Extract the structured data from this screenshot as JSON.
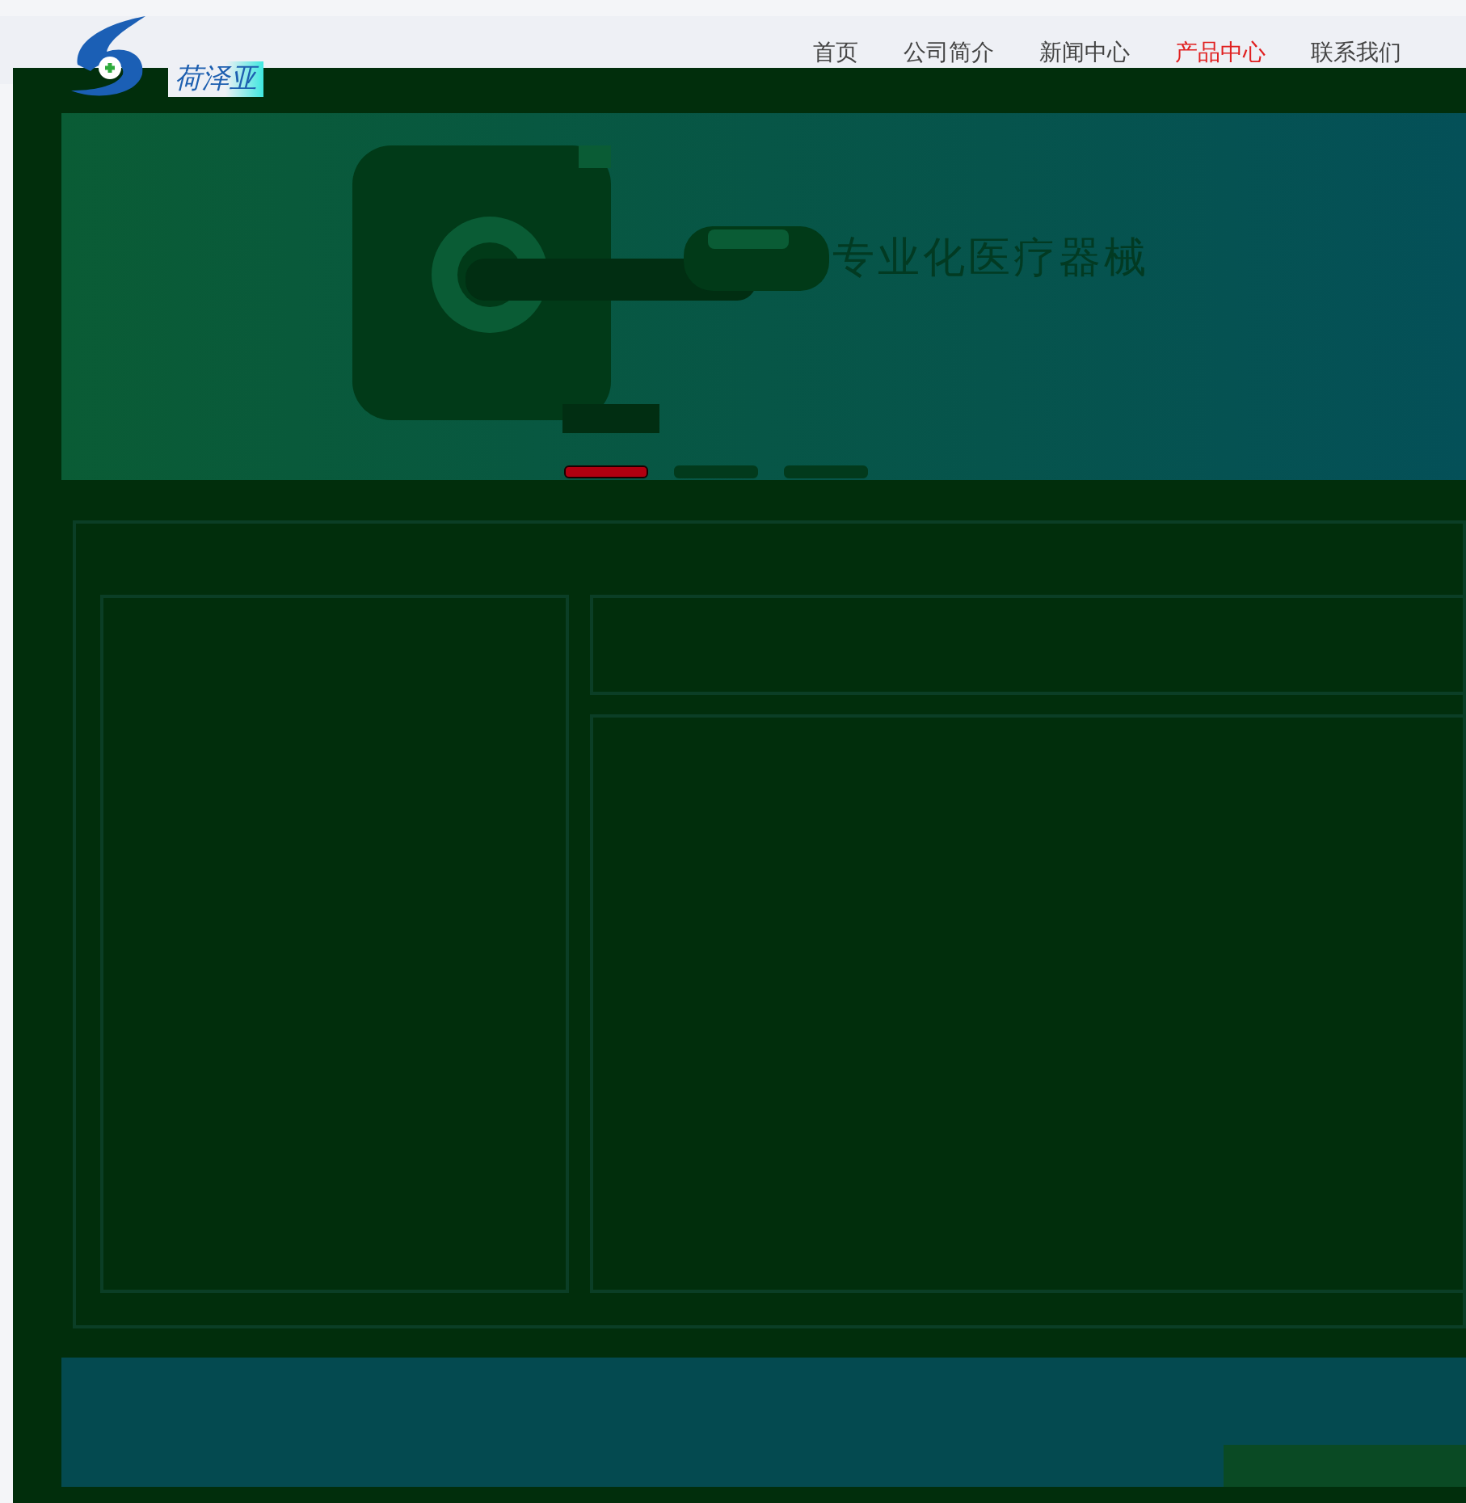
{
  "header": {
    "logo_text": "荷泽亚",
    "nav": [
      {
        "label": "首页",
        "selected": false
      },
      {
        "label": "公司简介",
        "selected": false
      },
      {
        "label": "新闻中心",
        "selected": false
      },
      {
        "label": "产品中心",
        "selected": true
      },
      {
        "label": "联系我们",
        "selected": false
      }
    ]
  },
  "banner": {
    "title": "专业化医疗器械",
    "slides": [
      {
        "selected": true
      },
      {
        "selected": false
      },
      {
        "selected": false
      }
    ]
  }
}
